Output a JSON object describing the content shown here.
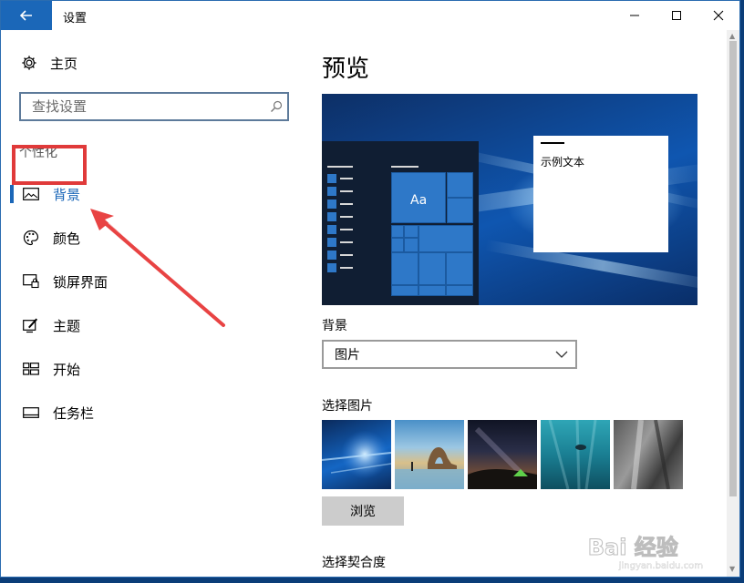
{
  "window": {
    "title": "设置"
  },
  "sidebar": {
    "home_label": "主页",
    "search_placeholder": "查找设置",
    "section_label": "个性化",
    "items": [
      {
        "label": "背景",
        "icon": "picture-icon",
        "selected": true
      },
      {
        "label": "颜色",
        "icon": "palette-icon",
        "selected": false
      },
      {
        "label": "锁屏界面",
        "icon": "lock-screen-icon",
        "selected": false
      },
      {
        "label": "主题",
        "icon": "theme-icon",
        "selected": false
      },
      {
        "label": "开始",
        "icon": "start-icon",
        "selected": false
      },
      {
        "label": "任务栏",
        "icon": "taskbar-icon",
        "selected": false
      }
    ]
  },
  "main": {
    "preview_heading": "预览",
    "preview_tile_label": "Aa",
    "preview_sample_text": "示例文本",
    "background_label": "背景",
    "background_value": "图片",
    "choose_picture_label": "选择图片",
    "browse_label": "浏览",
    "choose_fit_label": "选择契合度"
  },
  "thumbnails": [
    "windows-light-beams",
    "beach-rock-arch",
    "night-sky-tent",
    "underwater-swimmer",
    "rock-cliff"
  ],
  "watermark": {
    "logo": "Bai 经验",
    "url": "jingyan.baidu.com"
  },
  "colors": {
    "accent": "#1b67b8",
    "annotation": "#e03a3a"
  }
}
